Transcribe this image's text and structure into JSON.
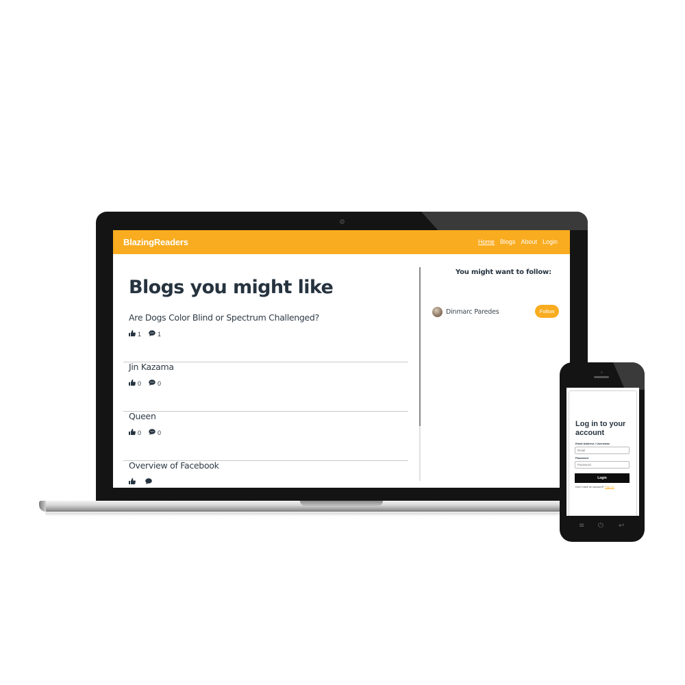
{
  "site": {
    "brand": "BlazingReaders",
    "nav": [
      "Home",
      "Blogs",
      "About",
      "Login"
    ]
  },
  "main": {
    "heading": "Blogs you might like",
    "posts": [
      {
        "title": "Are Dogs Color Blind or Spectrum Challenged?",
        "likes": "1",
        "comments": "1"
      },
      {
        "title": "Jin Kazama",
        "likes": "0",
        "comments": "0"
      },
      {
        "title": "Queen",
        "likes": "0",
        "comments": "0"
      },
      {
        "title": "Overview of Facebook",
        "likes": "",
        "comments": ""
      }
    ]
  },
  "sidebar": {
    "heading": "You might want to follow:",
    "users": [
      {
        "name": "Dinmarc Paredes",
        "button": "Follow"
      }
    ]
  },
  "phone": {
    "title": "Log in to your account",
    "email_label": "Email Address / Username",
    "email_placeholder": "Email",
    "password_label": "Password",
    "password_placeholder": "Password",
    "login_button": "Login",
    "signup_prompt": "Don't have an account?",
    "signup_link": "Sign up"
  },
  "colors": {
    "accent": "#f9ac1f",
    "heading": "#26333f",
    "device": "#141414"
  }
}
